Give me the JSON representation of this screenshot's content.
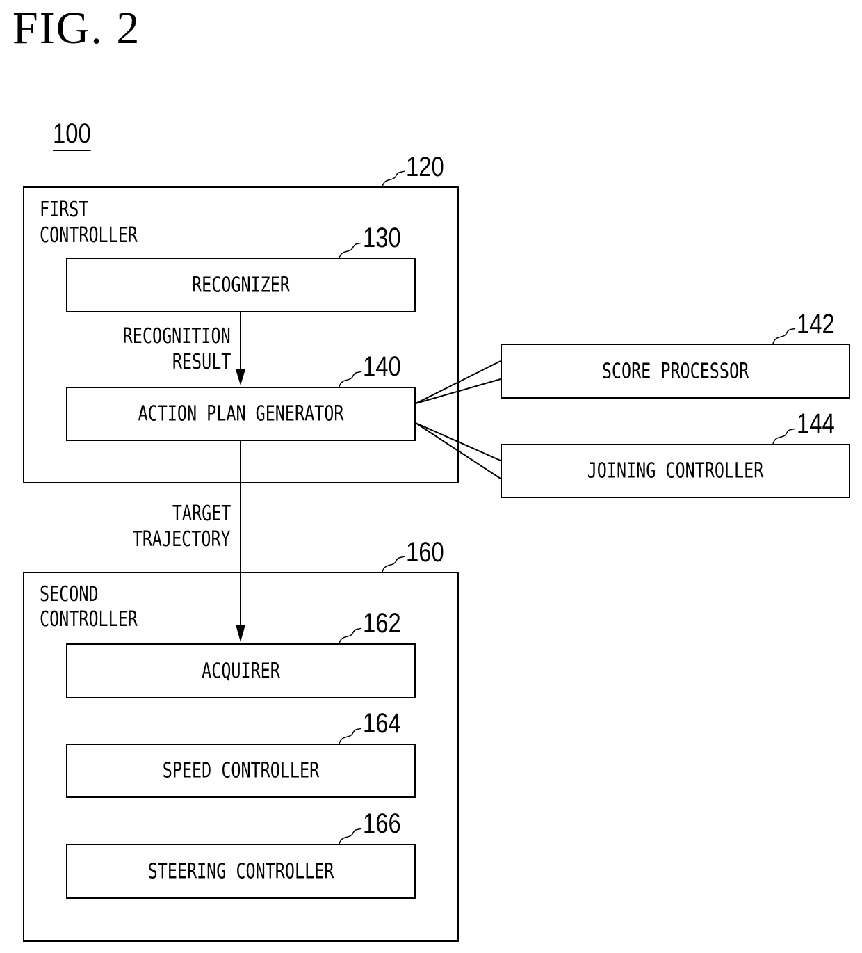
{
  "figure": {
    "title": "FIG. 2",
    "system_ref": "100"
  },
  "first_controller": {
    "ref": "120",
    "label_line1": "FIRST",
    "label_line2": "CONTROLLER",
    "recognizer": {
      "ref": "130",
      "label": "RECOGNIZER"
    },
    "action_plan_generator": {
      "ref": "140",
      "label": "ACTION PLAN GENERATOR"
    }
  },
  "sub_units": {
    "score_processor": {
      "ref": "142",
      "label": "SCORE PROCESSOR"
    },
    "joining_controller": {
      "ref": "144",
      "label": "JOINING CONTROLLER"
    }
  },
  "arrows": {
    "recognition_result_line1": "RECOGNITION",
    "recognition_result_line2": "RESULT",
    "target_trajectory_line1": "TARGET",
    "target_trajectory_line2": "TRAJECTORY"
  },
  "second_controller": {
    "ref": "160",
    "label_line1": "SECOND",
    "label_line2": "CONTROLLER",
    "acquirer": {
      "ref": "162",
      "label": "ACQUIRER"
    },
    "speed_controller": {
      "ref": "164",
      "label": "SPEED CONTROLLER"
    },
    "steering_controller": {
      "ref": "166",
      "label": "STEERING CONTROLLER"
    }
  }
}
